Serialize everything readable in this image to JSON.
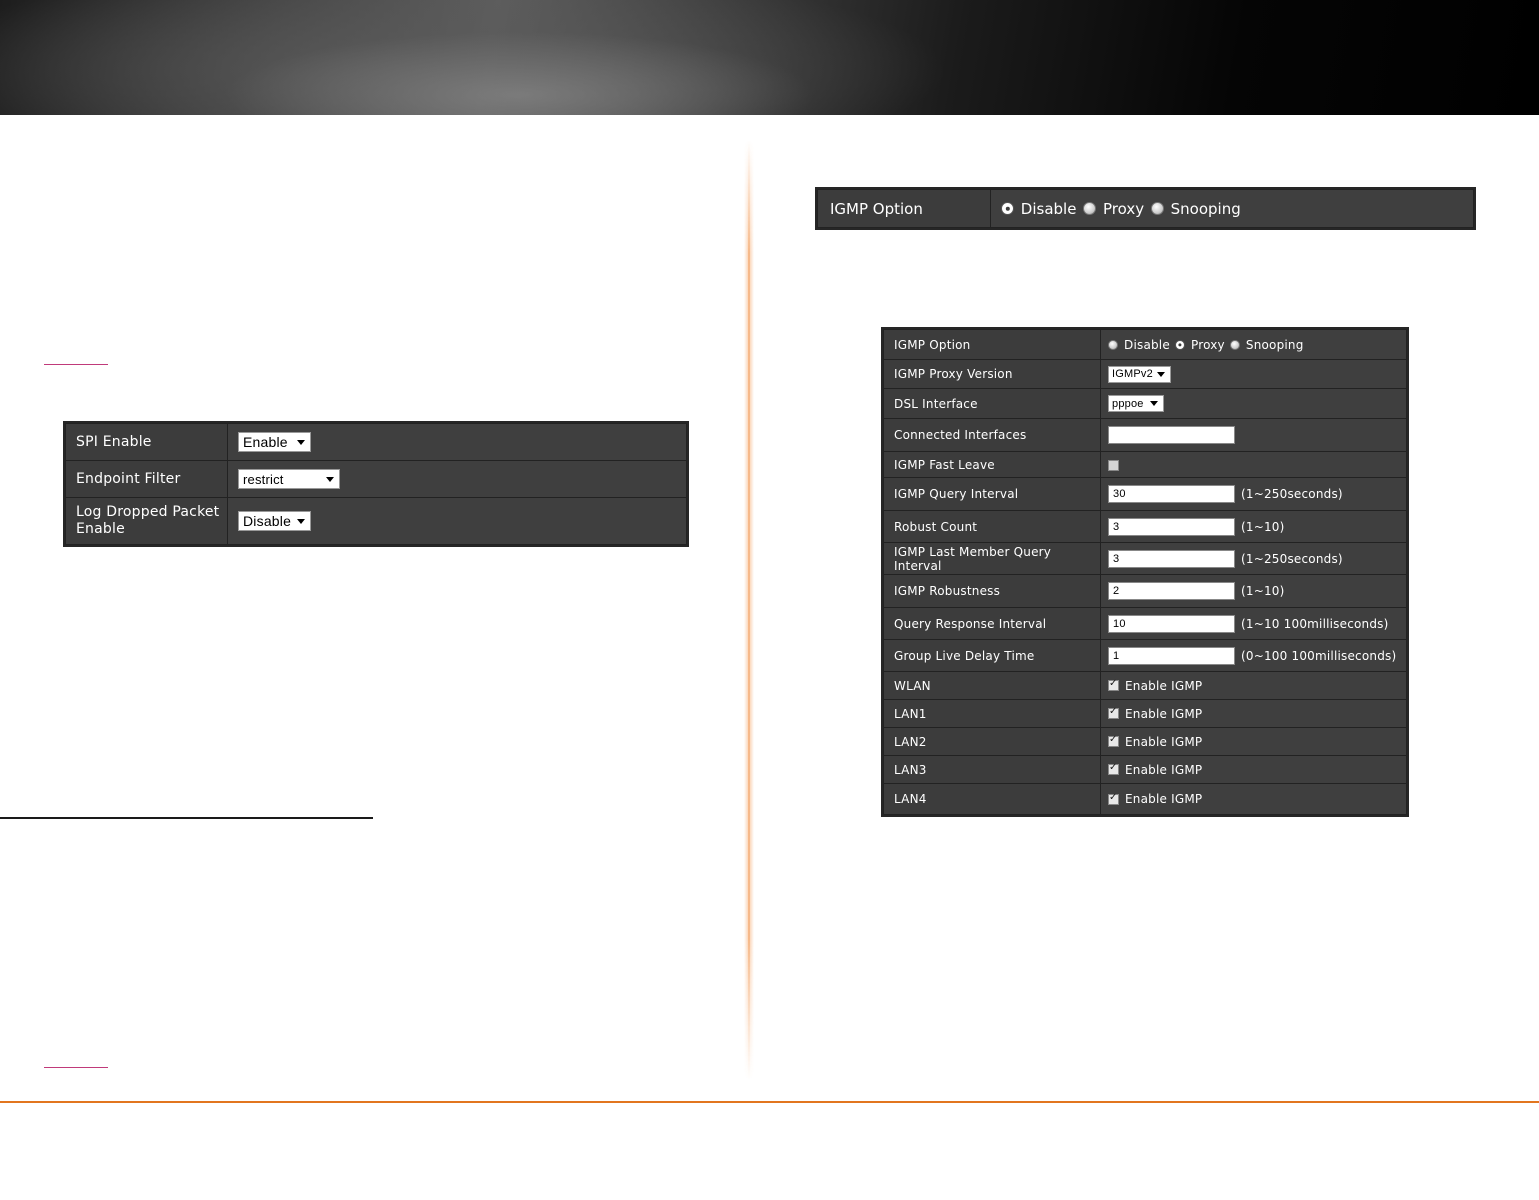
{
  "spi_panel": {
    "rows": [
      {
        "label": "SPI Enable",
        "value": "Enable"
      },
      {
        "label": "Endpoint Filter",
        "value": "restrict"
      },
      {
        "label_line1": "Log Dropped Packet",
        "label_line2": "Enable",
        "value": "Disable"
      }
    ]
  },
  "igmp_option_panel": {
    "label": "IGMP Option",
    "options": [
      "Disable",
      "Proxy",
      "Snooping"
    ],
    "selected": "Disable"
  },
  "igmp_settings_panel": {
    "igmp_option": {
      "label": "IGMP Option",
      "options": [
        "Disable",
        "Proxy",
        "Snooping"
      ],
      "selected": "Proxy"
    },
    "proxy_version": {
      "label": "IGMP Proxy Version",
      "value": "IGMPv2"
    },
    "dsl_interface": {
      "label": "DSL Interface",
      "value": "pppoe"
    },
    "connected_interfaces": {
      "label": "Connected Interfaces",
      "value": ""
    },
    "fast_leave": {
      "label": "IGMP Fast Leave",
      "checked": false
    },
    "query_interval": {
      "label": "IGMP Query Interval",
      "value": "30",
      "hint": "(1~250seconds)"
    },
    "robust_count": {
      "label": "Robust Count",
      "value": "3",
      "hint": "(1~10)"
    },
    "last_member_query_interval": {
      "label": "IGMP Last Member Query Interval",
      "value": "3",
      "hint": "(1~250seconds)"
    },
    "robustness": {
      "label": "IGMP Robustness",
      "value": "2",
      "hint": "(1~10)"
    },
    "query_response_interval": {
      "label": "Query Response Interval",
      "value": "10",
      "hint": "(1~10 100milliseconds)"
    },
    "group_live_delay": {
      "label": "Group Live Delay Time",
      "value": "1",
      "hint": "(0~100 100milliseconds)"
    },
    "interfaces": [
      {
        "label": "WLAN",
        "option": "Enable IGMP",
        "checked": true
      },
      {
        "label": "LAN1",
        "option": "Enable IGMP",
        "checked": true
      },
      {
        "label": "LAN2",
        "option": "Enable IGMP",
        "checked": true
      },
      {
        "label": "LAN3",
        "option": "Enable IGMP",
        "checked": true
      },
      {
        "label": "LAN4",
        "option": "Enable IGMP",
        "checked": true
      }
    ]
  }
}
